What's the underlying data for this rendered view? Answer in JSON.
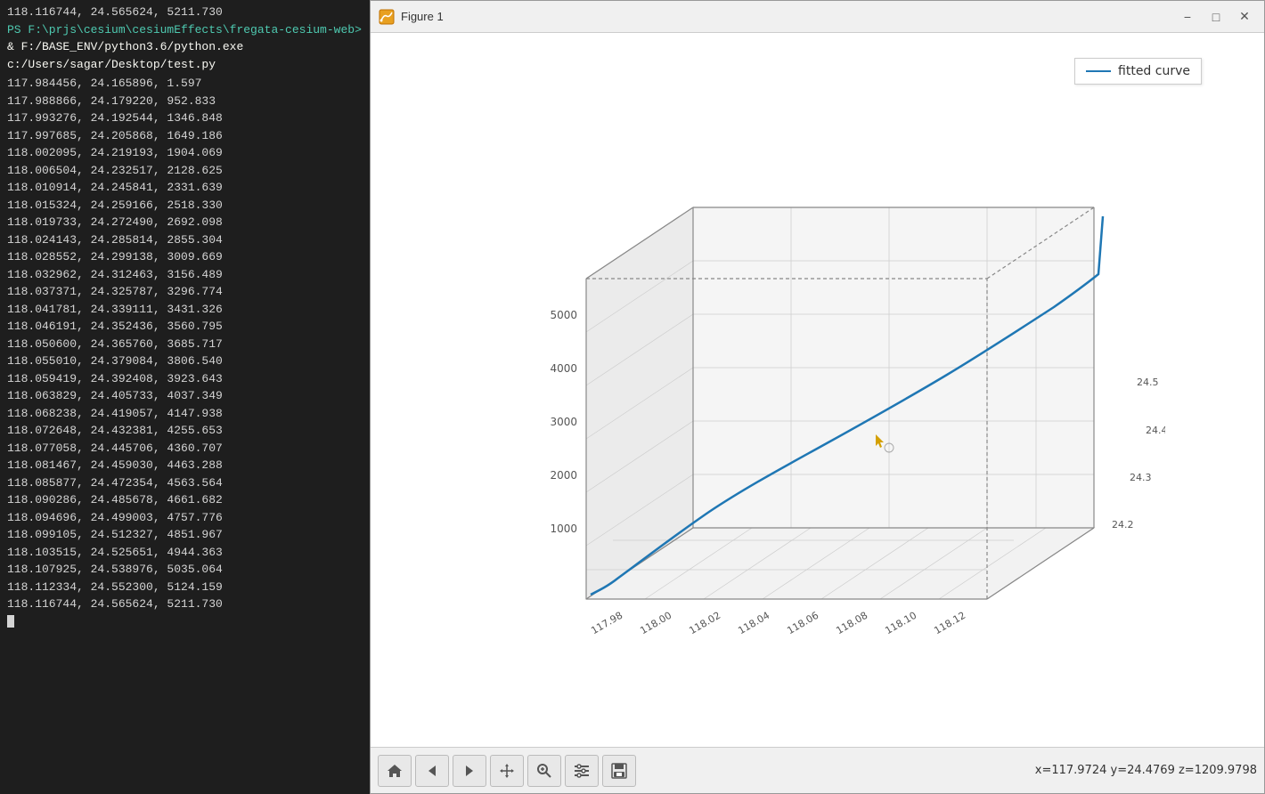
{
  "terminal": {
    "prompt_path": "PS F:\\prjs\\cesium\\cesiumEffects\\fregata-cesium-web>",
    "command": "& F:/BASE_ENV/python3.6/python.exe c:/Users/sagar/Desktop/test.py",
    "data_lines": [
      "118.116744,   24.565624,    5211.730",
      "117.984456,   24.165896,       1.597",
      "117.988866,   24.179220,     952.833",
      "117.993276,   24.192544,    1346.848",
      "117.997685,   24.205868,    1649.186",
      "118.002095,   24.219193,    1904.069",
      "118.006504,   24.232517,    2128.625",
      "118.010914,   24.245841,    2331.639",
      "118.015324,   24.259166,    2518.330",
      "118.019733,   24.272490,    2692.098",
      "118.024143,   24.285814,    2855.304",
      "118.028552,   24.299138,    3009.669",
      "118.032962,   24.312463,    3156.489",
      "118.037371,   24.325787,    3296.774",
      "118.041781,   24.339111,    3431.326",
      "118.046191,   24.352436,    3560.795",
      "118.050600,   24.365760,    3685.717",
      "118.055010,   24.379084,    3806.540",
      "118.059419,   24.392408,    3923.643",
      "118.063829,   24.405733,    4037.349",
      "118.068238,   24.419057,    4147.938",
      "118.072648,   24.432381,    4255.653",
      "118.077058,   24.445706,    4360.707",
      "118.081467,   24.459030,    4463.288",
      "118.085877,   24.472354,    4563.564",
      "118.090286,   24.485678,    4661.682",
      "118.094696,   24.499003,    4757.776",
      "118.099105,   24.512327,    4851.967",
      "118.103515,   24.525651,    4944.363",
      "118.107925,   24.538976,    5035.064",
      "118.112334,   24.552300,    5124.159",
      "118.116744,   24.565624,    5211.730"
    ]
  },
  "figure": {
    "title": "Figure 1",
    "legend_label": "fitted curve",
    "z_axis_labels": [
      "1000",
      "2000",
      "3000",
      "4000",
      "5000"
    ],
    "x_axis_labels": [
      "117.98",
      "118.00",
      "118.02",
      "118.04",
      "118.06",
      "118.08",
      "118.10",
      "118.12"
    ],
    "y_axis_labels": [
      "24.2",
      "24.3",
      "24.4",
      "24.5"
    ],
    "coords_display": "x=117.9724  y=24.4769  z=1209.9798",
    "toolbar": {
      "home_label": "🏠",
      "back_label": "←",
      "forward_label": "→",
      "pan_label": "✛",
      "zoom_label": "🔍",
      "settings_label": "⚙",
      "save_label": "💾"
    },
    "colors": {
      "curve": "#1f77b4",
      "grid": "#d0d0d0",
      "background": "#f8f8f8",
      "axis": "#888888"
    }
  }
}
